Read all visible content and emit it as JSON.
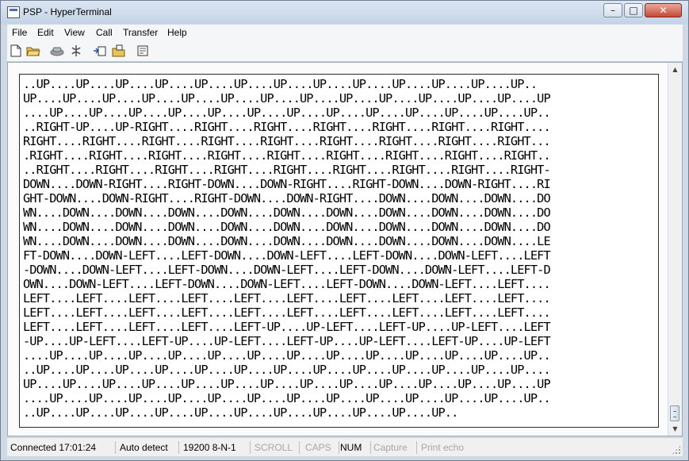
{
  "window": {
    "title": "PSP - HyperTerminal",
    "minimize_glyph": "–",
    "maximize_glyph": "□",
    "close_glyph": "✕"
  },
  "menu": {
    "items": [
      "File",
      "Edit",
      "View",
      "Call",
      "Transfer",
      "Help"
    ]
  },
  "toolbar": {
    "icons": [
      "new-document-icon",
      "open-folder-icon",
      "phone-connect-icon",
      "disconnect-icon",
      "send-file-icon",
      "receive-file-icon",
      "properties-icon"
    ]
  },
  "terminal": {
    "lines": [
      "..UP....UP....UP....UP....UP....UP....UP....UP....UP....UP....UP....UP....UP..",
      "UP....UP....UP....UP....UP....UP....UP....UP....UP....UP....UP....UP....UP....UP",
      "....UP....UP....UP....UP....UP....UP....UP....UP....UP....UP....UP....UP....UP..",
      "..RIGHT-UP....UP-RIGHT....RIGHT....RIGHT....RIGHT....RIGHT....RIGHT....RIGHT....",
      "RIGHT....RIGHT....RIGHT....RIGHT....RIGHT....RIGHT....RIGHT....RIGHT....RIGHT...",
      ".RIGHT....RIGHT....RIGHT....RIGHT....RIGHT....RIGHT....RIGHT....RIGHT....RIGHT..",
      "..RIGHT....RIGHT....RIGHT....RIGHT....RIGHT....RIGHT....RIGHT....RIGHT....RIGHT-",
      "DOWN....DOWN-RIGHT....RIGHT-DOWN....DOWN-RIGHT....RIGHT-DOWN....DOWN-RIGHT....RI",
      "GHT-DOWN....DOWN-RIGHT....RIGHT-DOWN....DOWN-RIGHT....DOWN....DOWN....DOWN....DO",
      "WN....DOWN....DOWN....DOWN....DOWN....DOWN....DOWN....DOWN....DOWN....DOWN....DO",
      "WN....DOWN....DOWN....DOWN....DOWN....DOWN....DOWN....DOWN....DOWN....DOWN....DO",
      "WN....DOWN....DOWN....DOWN....DOWN....DOWN....DOWN....DOWN....DOWN....DOWN....LE",
      "FT-DOWN....DOWN-LEFT....LEFT-DOWN....DOWN-LEFT....LEFT-DOWN....DOWN-LEFT....LEFT",
      "-DOWN....DOWN-LEFT....LEFT-DOWN....DOWN-LEFT....LEFT-DOWN....DOWN-LEFT....LEFT-D",
      "OWN....DOWN-LEFT....LEFT-DOWN....DOWN-LEFT....LEFT-DOWN....DOWN-LEFT....LEFT....",
      "LEFT....LEFT....LEFT....LEFT....LEFT....LEFT....LEFT....LEFT....LEFT....LEFT....",
      "LEFT....LEFT....LEFT....LEFT....LEFT....LEFT....LEFT....LEFT....LEFT....LEFT....",
      "LEFT....LEFT....LEFT....LEFT....LEFT-UP....UP-LEFT....LEFT-UP....UP-LEFT....LEFT",
      "-UP....UP-LEFT....LEFT-UP....UP-LEFT....LEFT-UP....UP-LEFT....LEFT-UP....UP-LEFT",
      "....UP....UP....UP....UP....UP....UP....UP....UP....UP....UP....UP....UP....UP..",
      "..UP....UP....UP....UP....UP....UP....UP....UP....UP....UP....UP....UP....UP....",
      "UP....UP....UP....UP....UP....UP....UP....UP....UP....UP....UP....UP....UP....UP",
      "....UP....UP....UP....UP....UP....UP....UP....UP....UP....UP....UP....UP....UP..",
      "..UP....UP....UP....UP....UP....UP....UP....UP....UP....UP....UP.."
    ]
  },
  "statusbar": {
    "connected": "Connected 17:01:24",
    "detect": "Auto detect",
    "settings": "19200 8-N-1",
    "scroll": "SCROLL",
    "caps": "CAPS",
    "num": "NUM",
    "capture": "Capture",
    "print_echo": "Print echo"
  }
}
